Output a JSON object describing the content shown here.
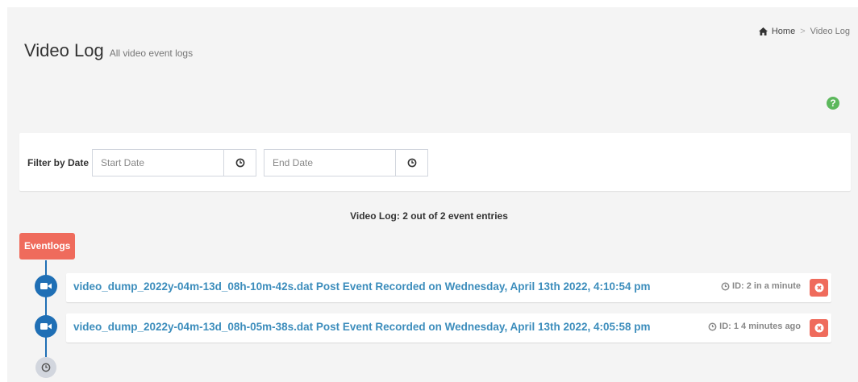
{
  "header": {
    "title": "Video Log",
    "subtitle": "All video event logs"
  },
  "breadcrumb": {
    "home": "Home",
    "separator": ">",
    "current": "Video Log"
  },
  "help_icon": "?",
  "filter": {
    "label": "Filter by Date",
    "start_placeholder": "Start Date",
    "start_value": "",
    "end_placeholder": "End Date",
    "end_value": "",
    "dash": "-"
  },
  "summary": "Video Log: 2 out of 2 event entries",
  "timeline": {
    "label": "Eventlogs",
    "items": [
      {
        "title": "video_dump_2022y-04m-13d_08h-10m-42s.dat Post Event Recorded on Wednesday, April 13th 2022, 4:10:54 pm",
        "meta": "ID: 2 in a minute"
      },
      {
        "title": "video_dump_2022y-04m-13d_08h-05m-38s.dat Post Event Recorded on Wednesday, April 13th 2022, 4:05:58 pm",
        "meta": "ID: 1 4 minutes ago"
      }
    ]
  },
  "colors": {
    "accent": "#3c8dbc",
    "timeline_blue": "#1f6fb5",
    "danger": "#ef6b5c",
    "help_green": "#5cb85c"
  }
}
